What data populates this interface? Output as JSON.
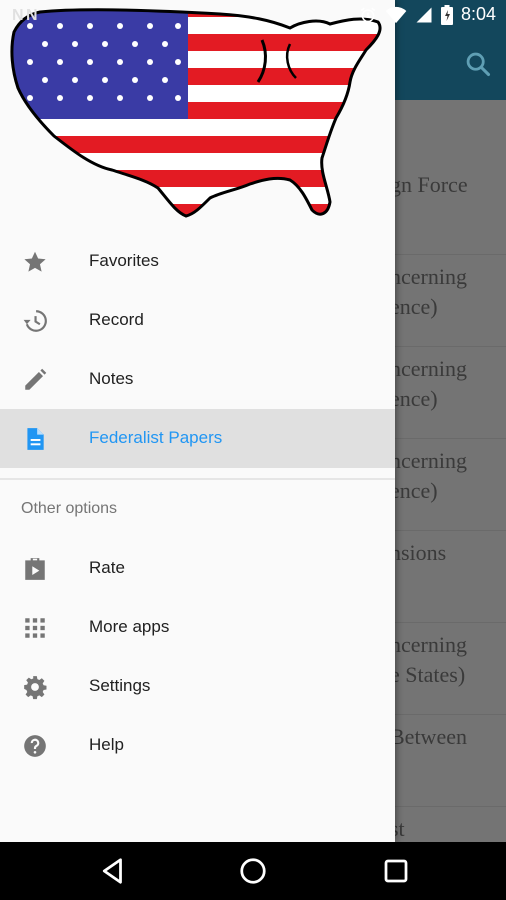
{
  "status_bar": {
    "left_icons": "N N",
    "time": "8:04"
  },
  "background_list": {
    "rows": [
      {
        "lines": [
          "gn Force"
        ]
      },
      {
        "lines": [
          "ncerning",
          "ence)"
        ]
      },
      {
        "lines": [
          "ncerning",
          "ence)"
        ]
      },
      {
        "lines": [
          "ncerning",
          "ence)"
        ]
      },
      {
        "lines": [
          "nsions"
        ]
      },
      {
        "lines": [
          "ncerning",
          "e States)"
        ]
      },
      {
        "lines": [
          "Between"
        ]
      },
      {
        "lines": [
          "st"
        ]
      }
    ]
  },
  "drawer": {
    "primary_items": [
      {
        "label": "Favorites",
        "icon": "star-icon"
      },
      {
        "label": "Record",
        "icon": "history-icon"
      },
      {
        "label": "Notes",
        "icon": "pencil-icon"
      },
      {
        "label": "Federalist Papers",
        "icon": "document-icon",
        "active": true
      }
    ],
    "section_title": "Other options",
    "secondary_items": [
      {
        "label": "Rate",
        "icon": "play-store-icon"
      },
      {
        "label": "More apps",
        "icon": "apps-grid-icon"
      },
      {
        "label": "Settings",
        "icon": "gear-icon"
      },
      {
        "label": "Help",
        "icon": "help-icon"
      }
    ]
  },
  "colors": {
    "accent": "#2196f3",
    "toolbar": "#13475c",
    "icon": "#757575"
  }
}
